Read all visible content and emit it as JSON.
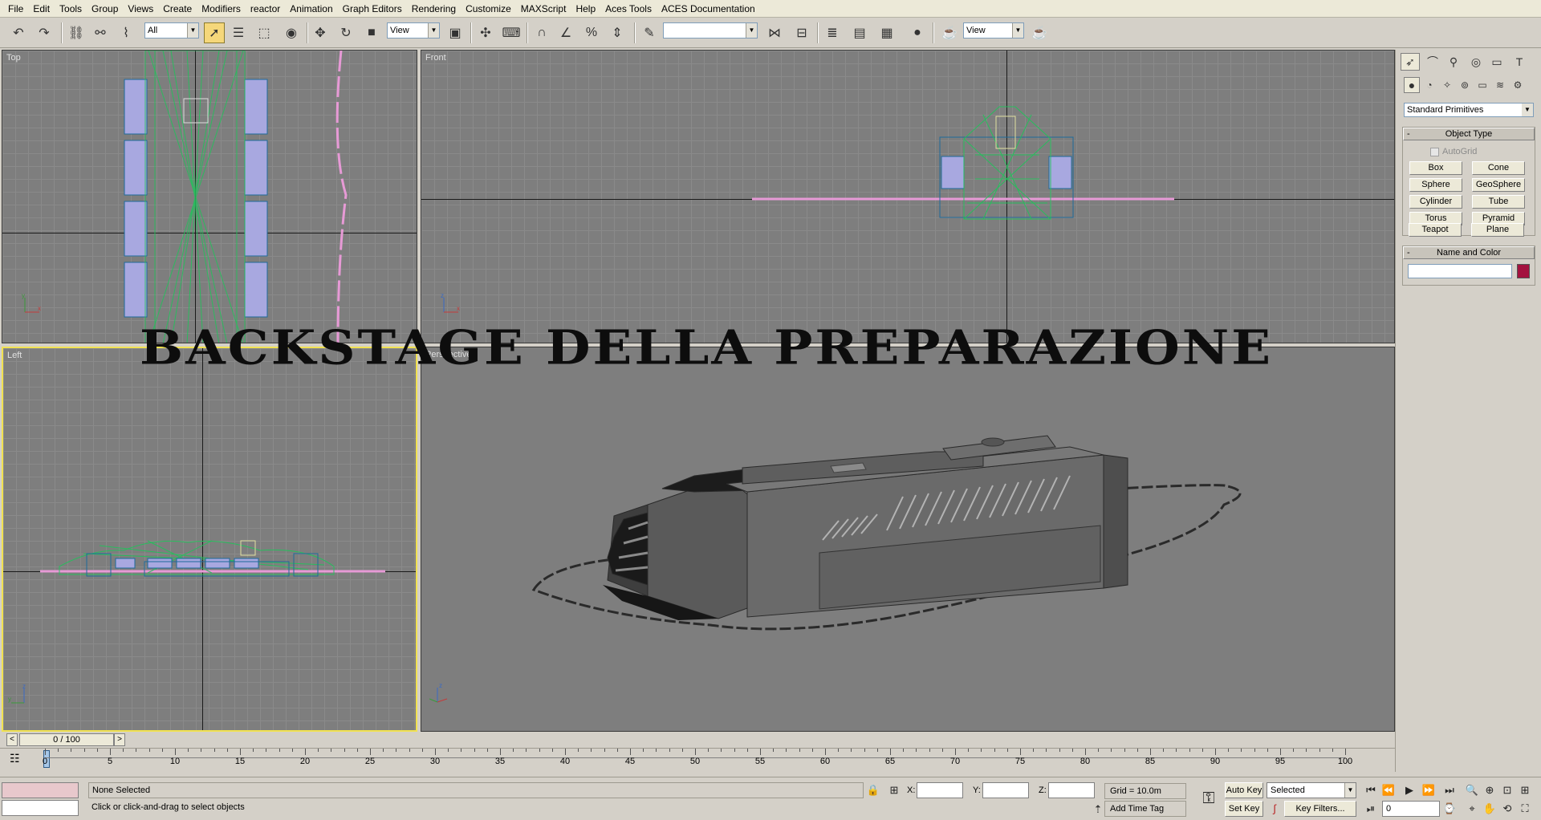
{
  "menu": [
    "File",
    "Edit",
    "Tools",
    "Group",
    "Views",
    "Create",
    "Modifiers",
    "reactor",
    "Animation",
    "Graph Editors",
    "Rendering",
    "Customize",
    "MAXScript",
    "Help",
    "Aces Tools",
    "ACES Documentation"
  ],
  "toolbar": {
    "selection_filter": "All",
    "ref_coord_1": "View",
    "named_selection": "",
    "ref_coord_2": "View",
    "icons": [
      "undo-icon",
      "redo-icon",
      "select-link-icon",
      "unlink-icon",
      "bind-space-warp-icon",
      "select-object-icon",
      "select-by-name-icon",
      "rect-region-icon",
      "window-crossing-icon",
      "move-icon",
      "rotate-icon",
      "scale-icon",
      "pivot-icon",
      "manipulate-icon",
      "keyboard-shortcut-icon",
      "snap-3d-icon",
      "angle-snap-icon",
      "percent-snap-icon",
      "spinner-snap-icon",
      "edit-named-selection-icon",
      "mirror-icon",
      "align-icon",
      "layer-manager-icon",
      "curve-editor-icon",
      "schematic-view-icon",
      "material-editor-icon",
      "render-setup-icon",
      "quick-render-icon"
    ]
  },
  "viewports": {
    "top": "Top",
    "front": "Front",
    "left": "Left",
    "perspective": "Perspective"
  },
  "overlay_title": "BACKSTAGE DELLA PREPARAZIONE",
  "command_panel": {
    "primitive_type": "Standard Primitives",
    "object_type_header": "Object Type",
    "autogrid": "AutoGrid",
    "buttons": [
      "Box",
      "Cone",
      "Sphere",
      "GeoSphere",
      "Cylinder",
      "Tube",
      "Torus",
      "Pyramid",
      "Teapot",
      "Plane"
    ],
    "name_color_header": "Name and Color",
    "swatch_color": "#a3123f",
    "tabs": [
      "create-tab-icon",
      "modify-tab-icon",
      "hierarchy-tab-icon",
      "motion-tab-icon",
      "display-tab-icon",
      "utilities-tab-icon"
    ],
    "subtabs": [
      "geometry-icon",
      "shapes-icon",
      "lights-icon",
      "cameras-icon",
      "helpers-icon",
      "space-warps-icon",
      "systems-icon"
    ]
  },
  "timeline": {
    "frame_counter": "0 / 100",
    "ticks": [
      "0",
      "5",
      "10",
      "15",
      "20",
      "25",
      "30",
      "35",
      "40",
      "45",
      "50",
      "55",
      "60",
      "65",
      "70",
      "75",
      "80",
      "85",
      "90",
      "95",
      "100"
    ]
  },
  "status": {
    "selection": "None Selected",
    "prompt": "Click or click-and-drag to select objects",
    "x_label": "X:",
    "y_label": "Y:",
    "z_label": "Z:",
    "x_value": "",
    "y_value": "",
    "z_value": "",
    "grid": "Grid = 10.0m",
    "add_time_tag": "Add Time Tag",
    "auto_key": "Auto Key",
    "set_key": "Set Key",
    "key_mode": "Selected",
    "key_filters": "Key Filters...",
    "current_frame": "0"
  }
}
